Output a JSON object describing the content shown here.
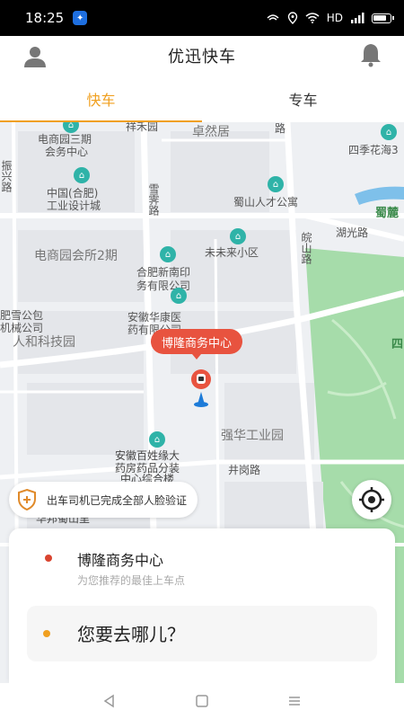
{
  "status_bar": {
    "time": "18:25",
    "network": "HD"
  },
  "header": {
    "title": "优迅快车"
  },
  "tabs": [
    {
      "label": "快车",
      "active": true
    },
    {
      "label": "专车",
      "active": false
    }
  ],
  "map": {
    "labels": {
      "l1": "祥禾园",
      "l2": "电商园三期",
      "l3": "会务中心",
      "l4": "卓然居",
      "l5": "路",
      "l6": "四季花海3",
      "l7": "振兴路",
      "l8": "中国(合肥)",
      "l9": "工业设计城",
      "l10": "雪霁路",
      "l11": "蜀山人才公寓",
      "l12": "蜀麓",
      "l13": "湖光路",
      "l14": "未未来小区",
      "l15": "皖山路",
      "l16": "电商园会所2期",
      "l17": "合肥新南印",
      "l18": "务有限公司",
      "l19": "肥雪公包",
      "l20": "机械公司",
      "l21": "安徽华康医",
      "l22": "药有限公司",
      "l23": "人和科技园",
      "l24": "四",
      "l25": "强华工业园",
      "l26": "安徽百姓缘大",
      "l27": "药房药品分装",
      "l28": "中心综合楼",
      "l29": "井岗路",
      "l30": "华邦蜀山里"
    },
    "pickup_bubble": "博隆商务中心",
    "verify_notice": "出车司机已完成全部人脸验证"
  },
  "card": {
    "pickup_name": "博隆商务中心",
    "pickup_hint": "为您推荐的最佳上车点",
    "destination_placeholder": "您要去哪儿？"
  },
  "colors": {
    "accent": "#f0a020",
    "pickup_red": "#e8533f",
    "park_green": "#9fd8a6"
  }
}
